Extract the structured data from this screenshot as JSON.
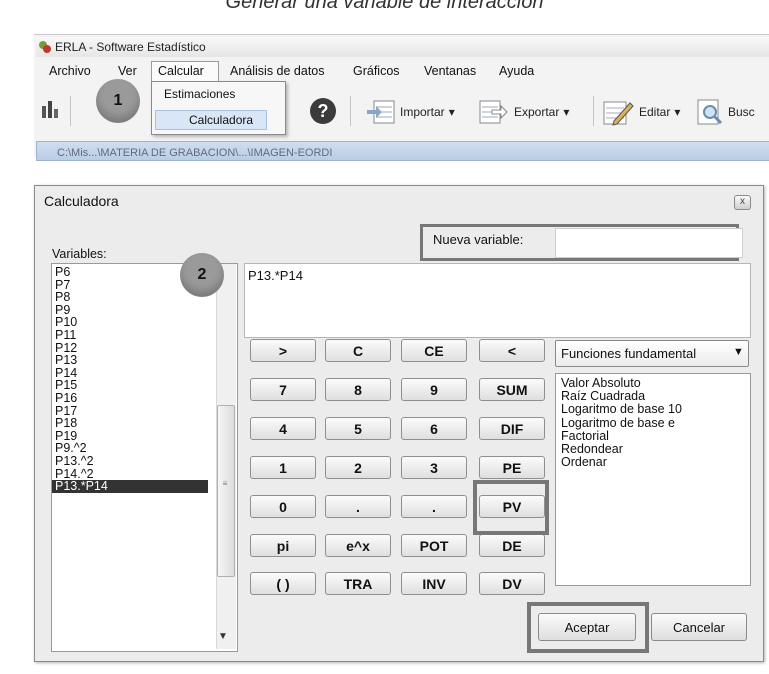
{
  "caption": "Generar una variable de interacción",
  "app": {
    "title": "ERLA - Software Estadístico",
    "menu": [
      "Archivo",
      "Ver",
      "Calcular",
      "Análisis de datos",
      "Gráficos",
      "Ventanas",
      "Ayuda"
    ],
    "calcular_dropdown": [
      "Estimaciones",
      "Calculadora"
    ],
    "toolbar": {
      "importar": "Importar",
      "exportar": "Exportar",
      "editar": "Editar",
      "buscar": "Busc"
    },
    "child_window_title": "C:\\Mis...\\MATERIA DE GRABACION\\...\\IMAGEN-EORDI"
  },
  "callouts": [
    "1",
    "2"
  ],
  "dialog": {
    "title": "Calculadora",
    "close_label": "x",
    "variables_label": "Variables:",
    "variables": [
      "P6",
      "P7",
      "P8",
      "P9",
      "P10",
      "P11",
      "P12",
      "P13",
      "P14",
      "P15",
      "P16",
      "P17",
      "P18",
      "P19",
      "P9.^2",
      "P13.^2",
      "P14.^2",
      "P13.*P14"
    ],
    "selected_variable": "P13.*P14",
    "new_variable_label": "Nueva variable:",
    "new_variable_value": "",
    "expression": "P13.*P14",
    "keypad": [
      [
        ">",
        "C",
        "CE",
        "<"
      ],
      [
        "7",
        "8",
        "9",
        "SUM"
      ],
      [
        "4",
        "5",
        "6",
        "DIF"
      ],
      [
        "1",
        "2",
        "3",
        "PE"
      ],
      [
        "0",
        ".",
        ".",
        "PV"
      ],
      [
        "pi",
        "e^x",
        "POT",
        "DE"
      ],
      [
        "( )",
        "TRA",
        "INV",
        "DV"
      ]
    ],
    "functions_select": "Funciones fundamental",
    "functions": [
      "Valor Absoluto",
      "Raíz Cuadrada",
      "Logaritmo de base 10",
      "Logaritmo de base e",
      "Factorial",
      "Redondear",
      "Ordenar"
    ],
    "ok_label": "Aceptar",
    "cancel_label": "Cancelar"
  }
}
